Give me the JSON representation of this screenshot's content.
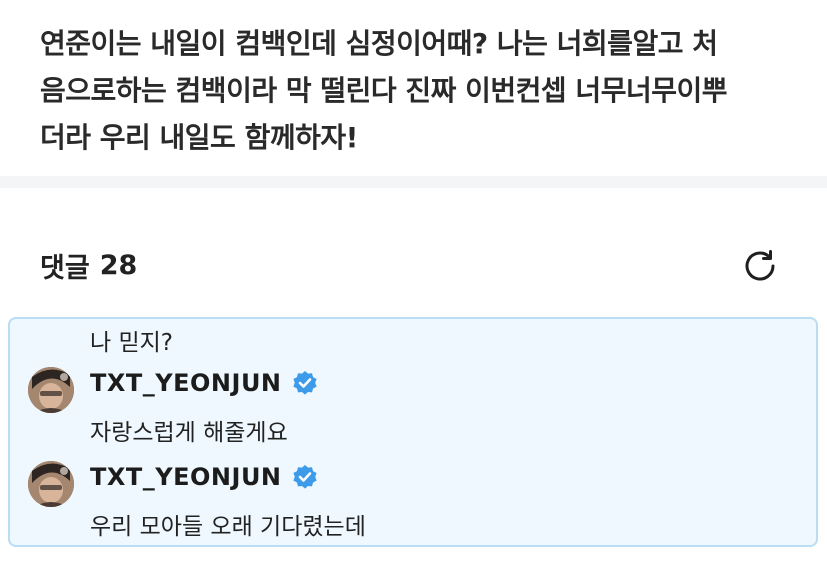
{
  "post": {
    "body": "연준이는 내일이 컴백인데 심정이어때? 나는 너희를알고 처\n음으로하는 컴백이라 막 떨린다 진짜 이번컨셉 너무너무이뿌\n더라 우리 내일도 함께하자!"
  },
  "comments_section": {
    "label": "댓글",
    "count": "28",
    "refresh_icon": "refresh-icon"
  },
  "thread": {
    "cut_text": "나 믿지?",
    "comments": [
      {
        "author": "TXT_YEONJUN",
        "verified": true,
        "text": "자랑스럽게 해줄게요"
      },
      {
        "author": "TXT_YEONJUN",
        "verified": true,
        "text": "우리 모아들 오래 기다렸는데"
      }
    ]
  },
  "colors": {
    "verified_badge": "#3d9be9",
    "highlight_bg": "#eef8fe",
    "highlight_border": "#b9ddf2",
    "divider": "#f4f5f7"
  }
}
